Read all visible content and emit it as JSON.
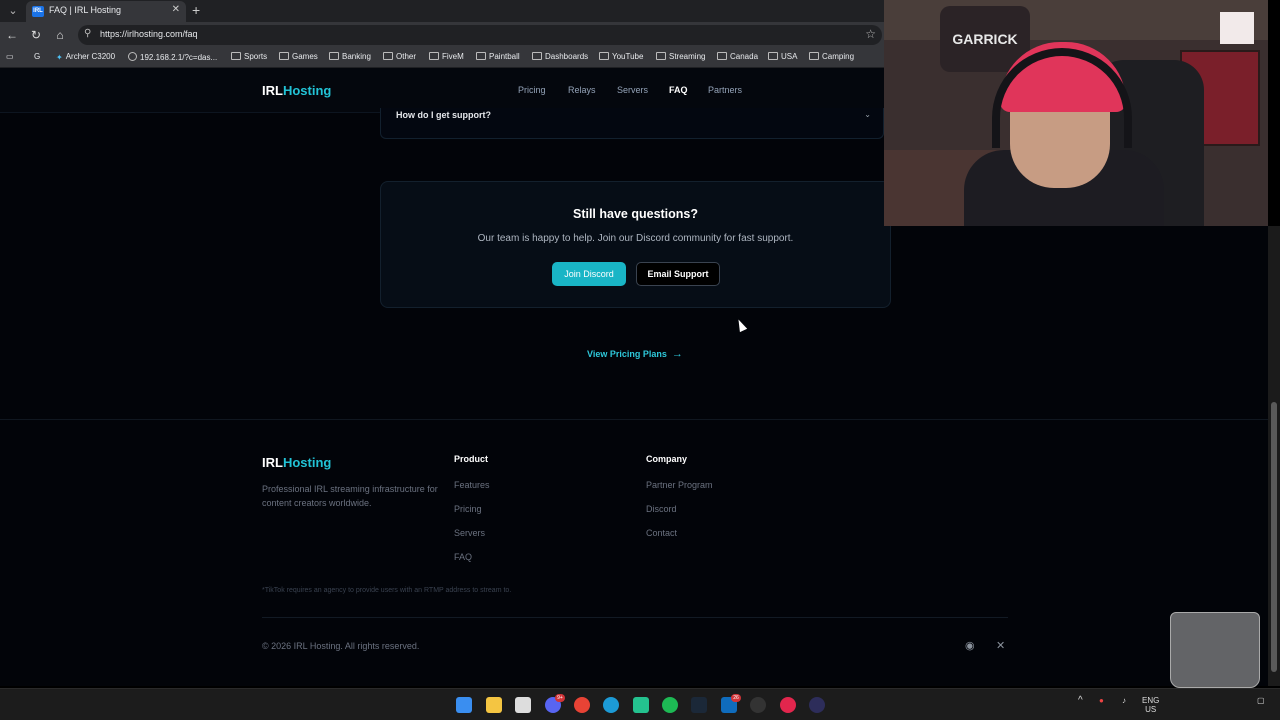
{
  "browser": {
    "tab_title": "FAQ | IRL Hosting",
    "tab_favicon": "IRL",
    "url": "https://irlhosting.com/faq",
    "bookmarks": [
      "Archer C3200",
      "192.168.2.1/?c=das...",
      "Sports",
      "Games",
      "Banking",
      "Other",
      "FiveM",
      "Paintball",
      "Dashboards",
      "YouTube",
      "Streaming",
      "Canada",
      "USA",
      "Camping"
    ]
  },
  "site": {
    "logo_main": "IRL",
    "logo_accent": "Hosting",
    "nav": [
      "Pricing",
      "Relays",
      "Servers",
      "FAQ",
      "Partners"
    ],
    "active_nav": "FAQ",
    "accent_color": "#22c3d6"
  },
  "faq": {
    "question": "How do I get support?"
  },
  "cta": {
    "heading": "Still have questions?",
    "text": "Our team is happy to help. Join our Discord community for fast support.",
    "discord_label": "Join Discord",
    "email_label": "Email Support"
  },
  "pricing_link": "View Pricing Plans",
  "footer": {
    "logo_main": "IRL",
    "logo_accent": "Hosting",
    "description": "Professional IRL streaming infrastructure for content creators worldwide.",
    "product_heading": "Product",
    "product_links": [
      "Features",
      "Pricing",
      "Servers",
      "FAQ"
    ],
    "company_heading": "Company",
    "company_links": [
      "Partner Program",
      "Discord",
      "Contact"
    ],
    "note": "*TikTok requires an agency to provide users with an RTMP address to stream to.",
    "copyright": "© 2026 IRL Hosting. All rights reserved."
  },
  "webcam": {
    "logo_text": "GARRICK"
  },
  "taskbar": {
    "lang_top": "ENG",
    "lang_bottom": "US",
    "badge_discord": "9+",
    "badge_mail": "26"
  }
}
